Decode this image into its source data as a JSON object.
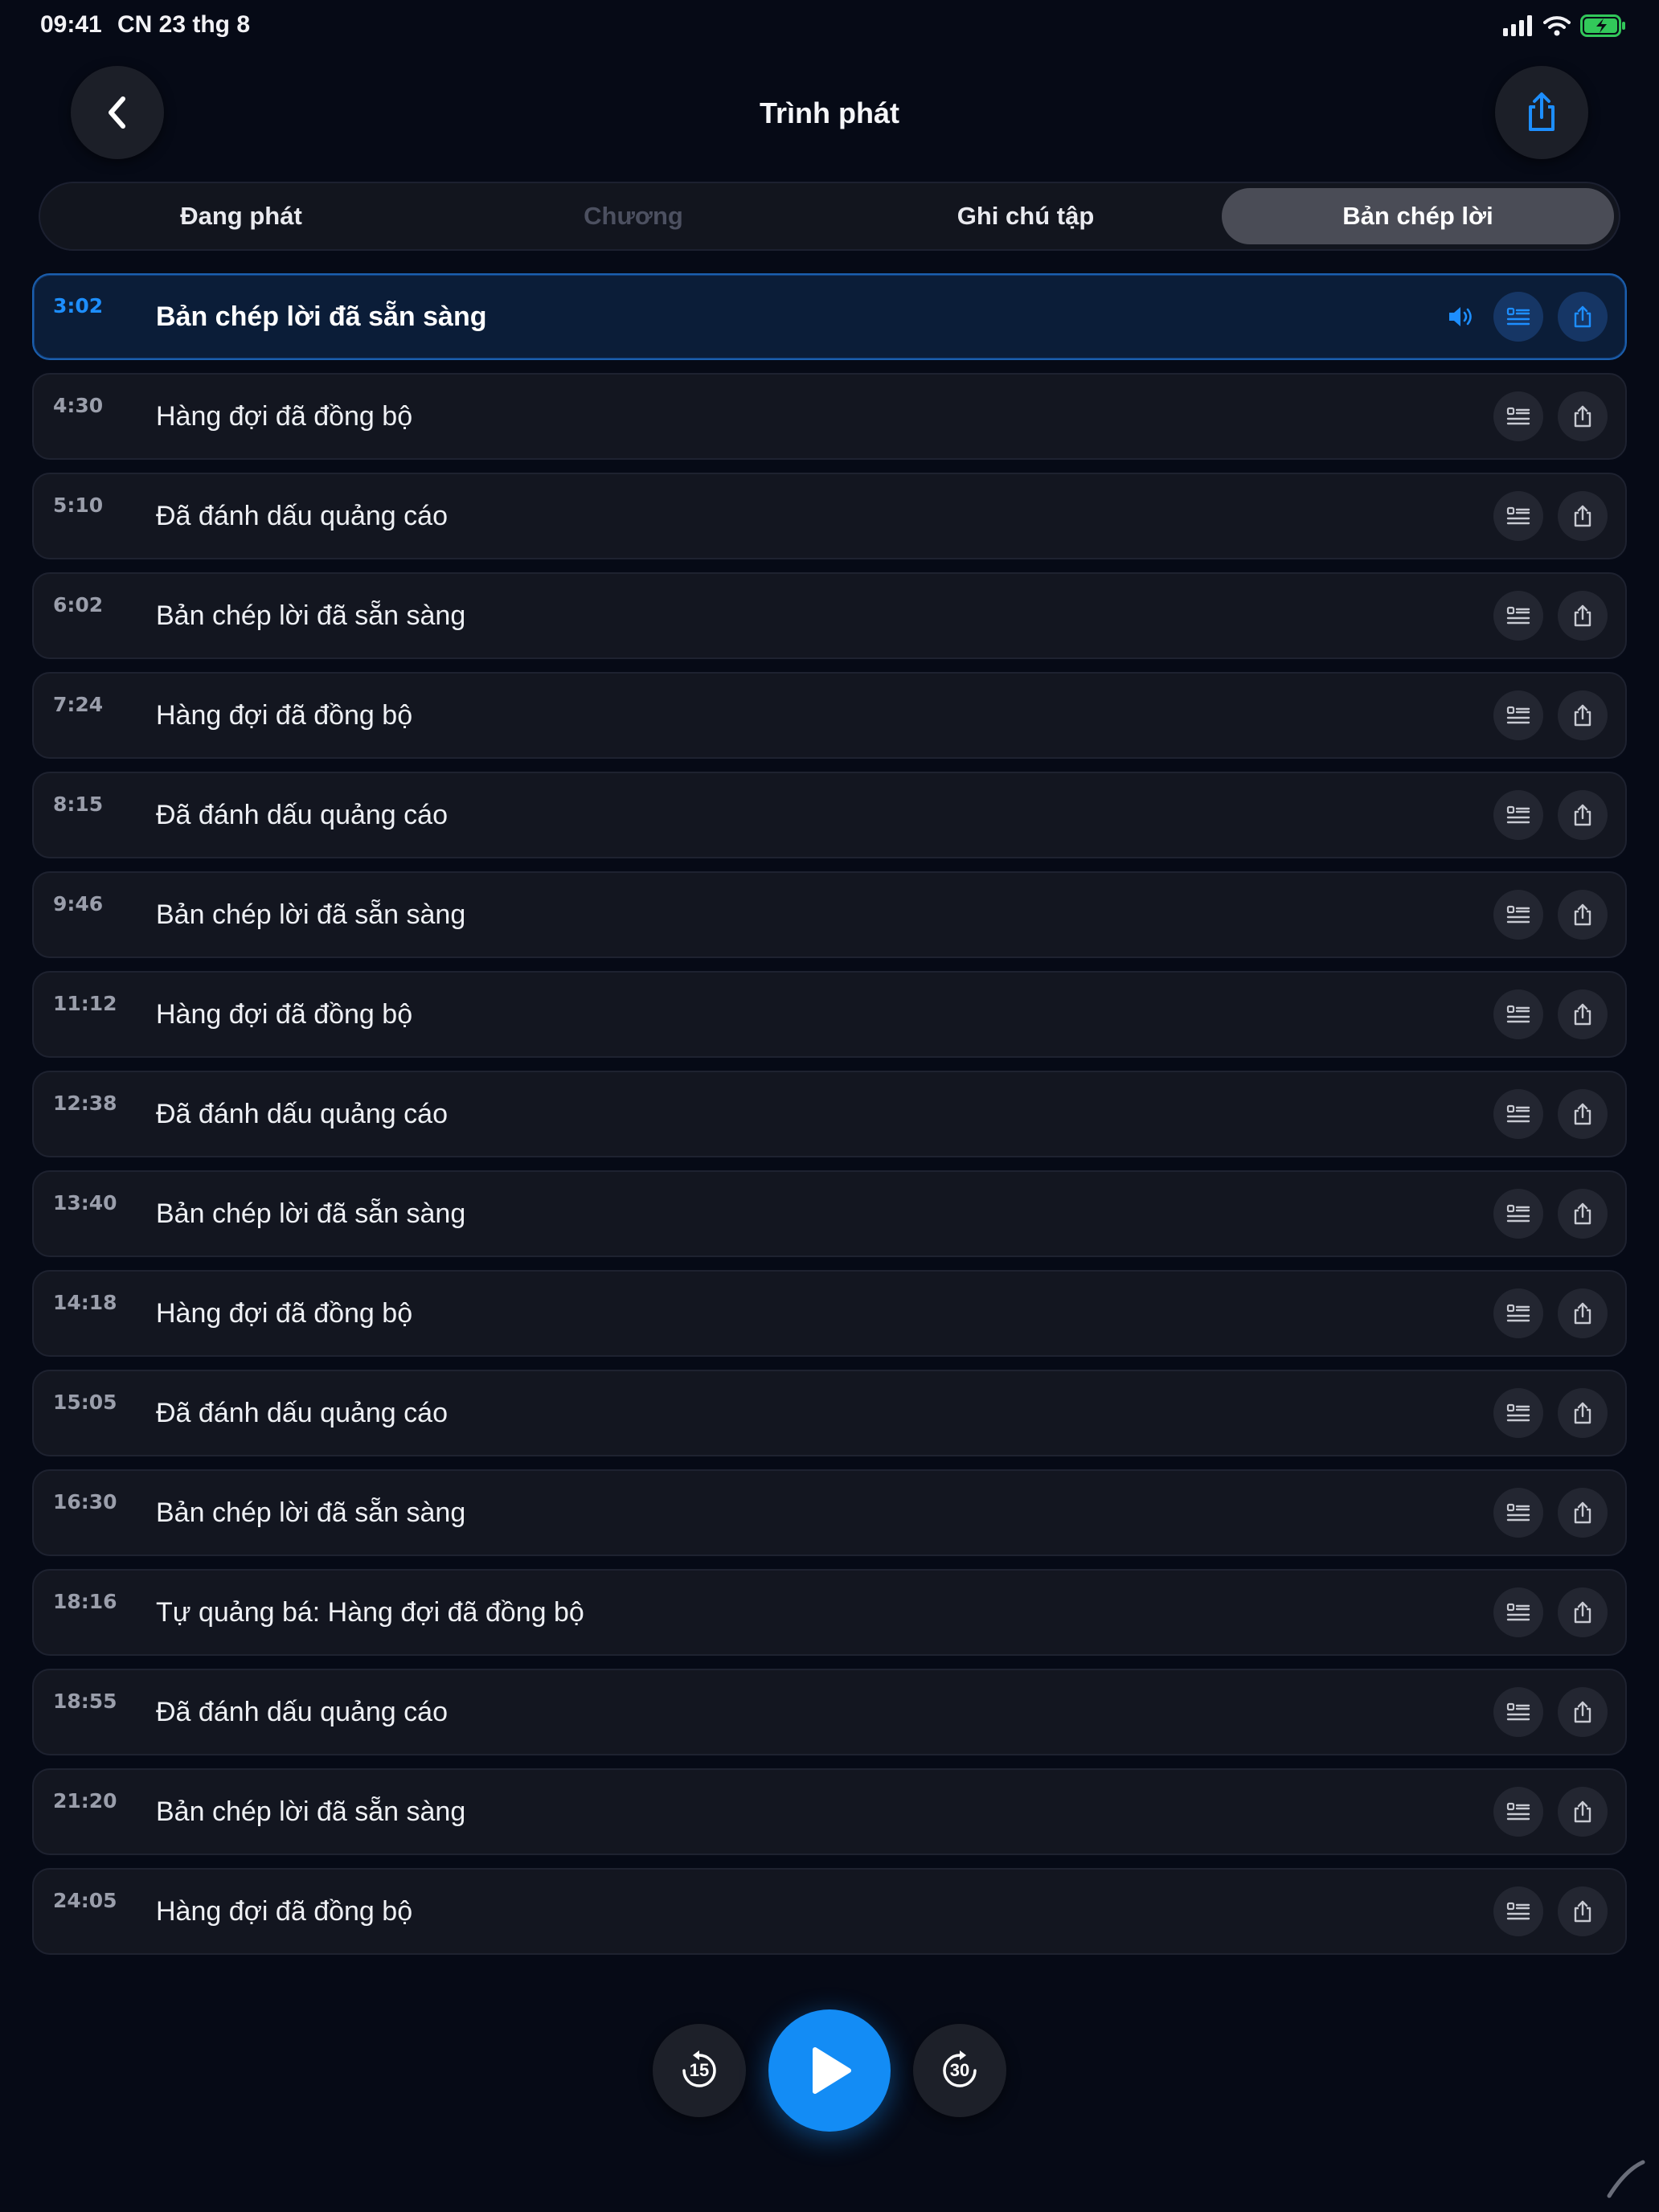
{
  "status_bar": {
    "time": "09:41",
    "date": "CN 23 thg 8",
    "icons": [
      "cellular-signal-icon",
      "wifi-icon",
      "battery-charging-icon"
    ]
  },
  "header": {
    "title": "Trình phát",
    "back_icon": "chevron-left-icon",
    "share_icon": "share-icon"
  },
  "tabs": [
    {
      "label": "Đang phát",
      "state": "normal"
    },
    {
      "label": "Chương",
      "state": "disabled"
    },
    {
      "label": "Ghi chú tập",
      "state": "normal"
    },
    {
      "label": "Bản chép lời",
      "state": "selected"
    }
  ],
  "transcript": [
    {
      "time": "3:02",
      "text": "Bản chép lời đã sẵn sàng",
      "playing": true
    },
    {
      "time": "4:30",
      "text": "Hàng đợi đã đồng bộ"
    },
    {
      "time": "5:10",
      "text": "Đã đánh dấu quảng cáo"
    },
    {
      "time": "6:02",
      "text": "Bản chép lời đã sẵn sàng"
    },
    {
      "time": "7:24",
      "text": "Hàng đợi đã đồng bộ"
    },
    {
      "time": "8:15",
      "text": "Đã đánh dấu quảng cáo"
    },
    {
      "time": "9:46",
      "text": "Bản chép lời đã sẵn sàng"
    },
    {
      "time": "11:12",
      "text": "Hàng đợi đã đồng bộ"
    },
    {
      "time": "12:38",
      "text": "Đã đánh dấu quảng cáo"
    },
    {
      "time": "13:40",
      "text": "Bản chép lời đã sẵn sàng"
    },
    {
      "time": "14:18",
      "text": "Hàng đợi đã đồng bộ"
    },
    {
      "time": "15:05",
      "text": "Đã đánh dấu quảng cáo"
    },
    {
      "time": "16:30",
      "text": "Bản chép lời đã sẵn sàng"
    },
    {
      "time": "18:16",
      "text": "Tự quảng bá: Hàng đợi đã đồng bộ"
    },
    {
      "time": "18:55",
      "text": "Đã đánh dấu quảng cáo"
    },
    {
      "time": "21:20",
      "text": "Bản chép lời đã sẵn sàng"
    },
    {
      "time": "24:05",
      "text": "Hàng đợi đã đồng bộ"
    }
  ],
  "row_icons": [
    "transcript-list-icon",
    "share-icon",
    "speaker-icon"
  ],
  "player": {
    "skip_back_label": "15",
    "skip_forward_label": "30",
    "play_icon": "play-icon"
  },
  "colors": {
    "accent": "#138cf5",
    "background": "#060a16",
    "row_background": "#131620",
    "active_row_background": "#0b1d38",
    "battery": "#32c85a"
  }
}
